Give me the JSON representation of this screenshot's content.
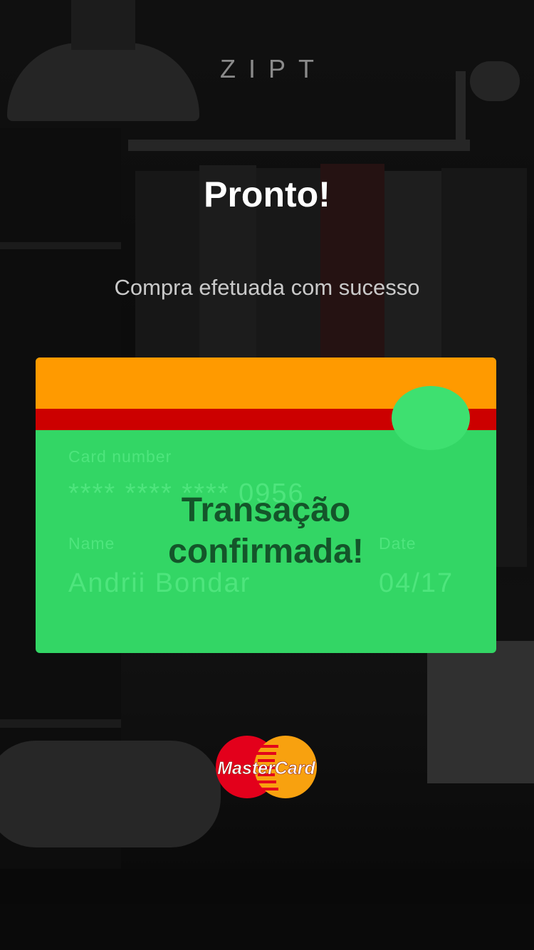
{
  "brand": "ZIPT",
  "title": "Pronto!",
  "subtitle": "Compra efetuada com sucesso",
  "card": {
    "number_label": "Card number",
    "number_value": "**** **** **** 0956",
    "name_label": "Name",
    "name_value": "Andrii Bondar",
    "date_label": "Date",
    "date_value": "04/17",
    "overlay_line1": "Transação",
    "overlay_line2": "confirmada!"
  },
  "mastercard_logo": "MasterCard",
  "colors": {
    "card_green": "#33d665",
    "band_orange": "#ff9a00",
    "band_red": "#cc0000",
    "overlay_text": "#14552a",
    "mc_red": "#e3001b",
    "mc_yellow": "#f8a10f"
  }
}
